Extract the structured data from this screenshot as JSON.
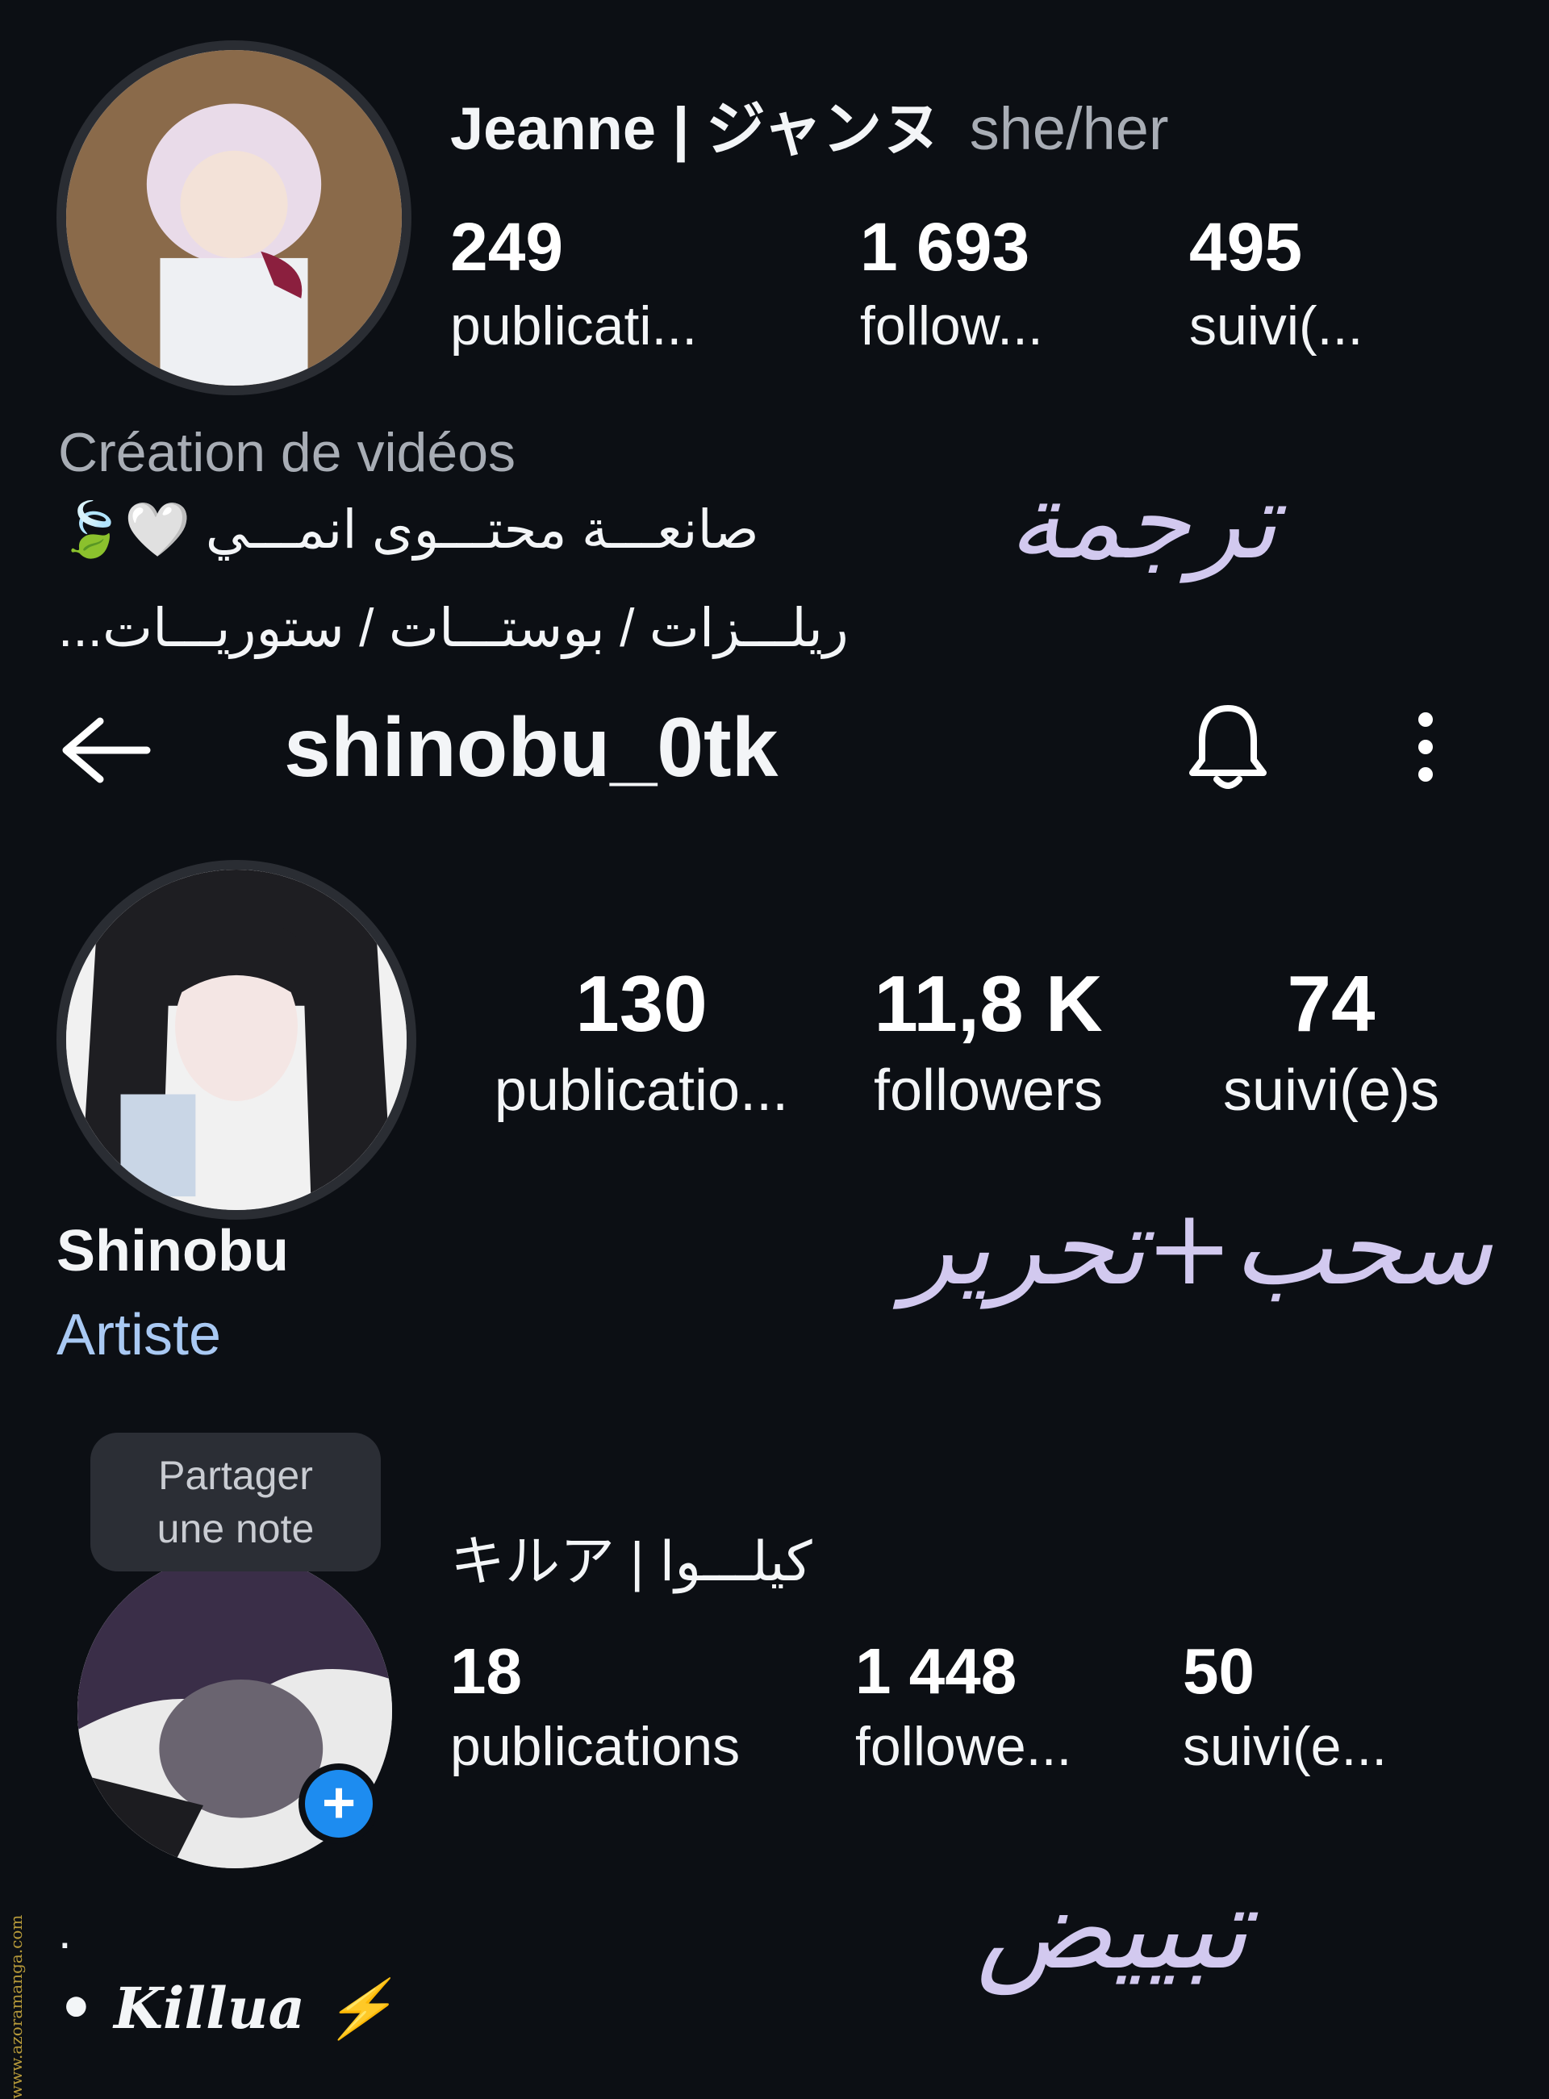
{
  "profile_top": {
    "name": "Jeanne | ジャンヌ",
    "pronouns": "she/her",
    "stats": [
      {
        "value": "249",
        "label": "publicati..."
      },
      {
        "value": "1 693",
        "label": "follow..."
      },
      {
        "value": "495",
        "label": "suivi(..."
      }
    ],
    "category": "Création de vidéos",
    "bio_line1": "صانعـــة محتـــوى انمـــي 🤍🍃",
    "bio_line2": "ريلـــزات / بوستـــات / ستوريـــات..."
  },
  "header": {
    "username": "shinobu_0tk",
    "back_icon": "arrow-left-icon",
    "bell_icon": "bell-icon",
    "more_icon": "more-vertical-icon"
  },
  "profile_main": {
    "stats": [
      {
        "value": "130",
        "label": "publicatio..."
      },
      {
        "value": "11,8 K",
        "label": "followers"
      },
      {
        "value": "74",
        "label": "suivi(e)s"
      }
    ],
    "display_name": "Shinobu",
    "category": "Artiste"
  },
  "profile_bottom": {
    "note_bubble": {
      "line1": "Partager",
      "line2": "une note"
    },
    "name": "キルア | كيلـــوا",
    "stats": [
      {
        "value": "18",
        "label": "publications"
      },
      {
        "value": "1 448",
        "label": "followe..."
      },
      {
        "value": "50",
        "label": "suivi(e..."
      }
    ],
    "bio_dot": ".",
    "bio_name": "• Killua ⚡",
    "add_icon": "plus-icon"
  },
  "annotations": {
    "translate": "ترجمة",
    "crop_edit": "سحب+تحرير",
    "bleach": "تبييض"
  },
  "watermark": "www.azoramanga.com",
  "colors": {
    "background": "#0c0f14",
    "accent_blue": "#a9c9f3",
    "badge_blue": "#1d8cf0",
    "handwriting": "#d2c9ef"
  }
}
